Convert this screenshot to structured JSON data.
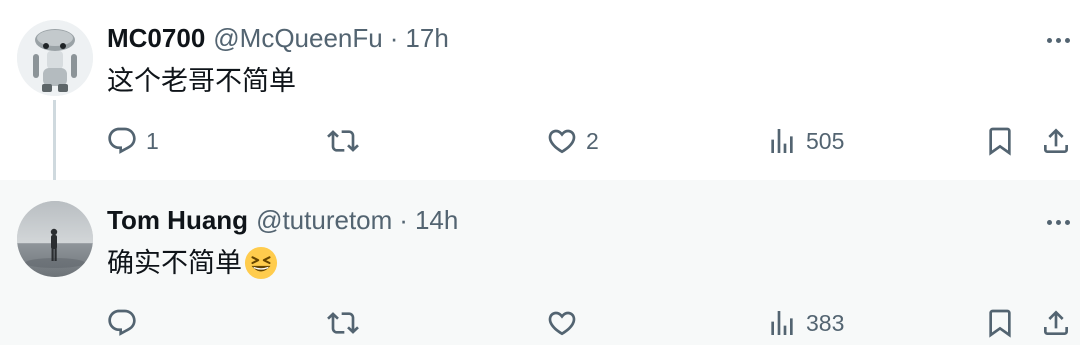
{
  "tweets": [
    {
      "display_name": "MC0700",
      "handle": "@McQueenFu",
      "separator": "·",
      "time": "17h",
      "text": "这个老哥不简单",
      "emoji": "",
      "avatar_icon": "robot-avatar",
      "stats": {
        "replies": "1",
        "retweets": "",
        "likes": "2",
        "views": "505"
      }
    },
    {
      "display_name": "Tom Huang",
      "handle": "@tuturetom",
      "separator": "·",
      "time": "14h",
      "text": "确实不简单",
      "emoji": "grinning-squinting-face-emoji",
      "avatar_icon": "photo-avatar",
      "stats": {
        "replies": "",
        "retweets": "",
        "likes": "",
        "views": "383"
      }
    }
  ],
  "colors": {
    "text": "#0f1419",
    "secondary": "#536471",
    "thread_line": "#cfd9de",
    "reply_background": "#f7f9f9"
  }
}
